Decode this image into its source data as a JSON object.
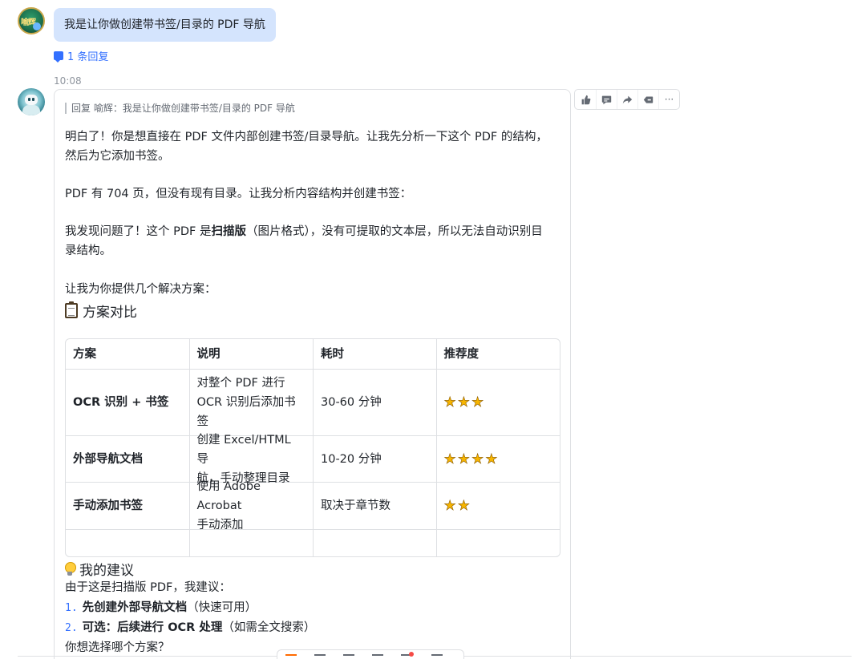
{
  "user_message": {
    "avatar_text": "喻辉",
    "text": "我是让你做创建带书签/目录的 PDF 导航",
    "reply_count": "1 条回复"
  },
  "bot_message": {
    "timestamp": "10:08",
    "quote": "回复 喻辉：我是让你做创建带书签/目录的 PDF 导航",
    "p1_line1": "明白了！你是想直接在 PDF 文件内部创建书签/目录导航。让我先分析一下这个 PDF 的结构，",
    "p1_line2": "然后为它添加书签。",
    "p2": "PDF 有 704 页，但没有现有目录。让我分析内容结构并创建书签：",
    "p3_pre": "我发现问题了！这个 PDF 是",
    "p3_bold": "扫描版",
    "p3_post": "（图片格式），没有可提取的文本层，所以无法自动识别目",
    "p3_line2": "录结构。",
    "p4": "让我为你提供几个解决方案：",
    "heading1": "方案对比",
    "table": {
      "headers": [
        "方案",
        "说明",
        "耗时",
        "推荐度"
      ],
      "rows": [
        {
          "plan": "OCR 识别 + 书签",
          "desc_lines": [
            "对整个 PDF 进行",
            "OCR 识别后添加书",
            "签"
          ],
          "time": "30-60 分钟",
          "stars": 3
        },
        {
          "plan": "外部导航文档",
          "desc_lines": [
            "创建 Excel/HTML 导",
            "航，手动整理目录"
          ],
          "time": "10-20 分钟",
          "stars": 4
        },
        {
          "plan": "手动添加书签",
          "desc_lines": [
            "使用 Adobe Acrobat",
            "手动添加"
          ],
          "time": "取决于章节数",
          "stars": 2
        }
      ]
    },
    "heading2": "我的建议",
    "advice_intro": "由于这是扫描版 PDF，我建议：",
    "advice_items": [
      {
        "num": "1.",
        "bold": "先创建外部导航文档",
        "rest": "（快速可用）"
      },
      {
        "num": "2.",
        "bold": "可选：后续进行 OCR 处理",
        "rest": "（如需全文搜索）"
      }
    ],
    "question": "你想选择哪个方案？"
  },
  "actions": {
    "more": "···"
  },
  "icons": [
    "thumbs-up-icon",
    "comment-icon",
    "share-icon",
    "tag-icon",
    "more-icon"
  ]
}
